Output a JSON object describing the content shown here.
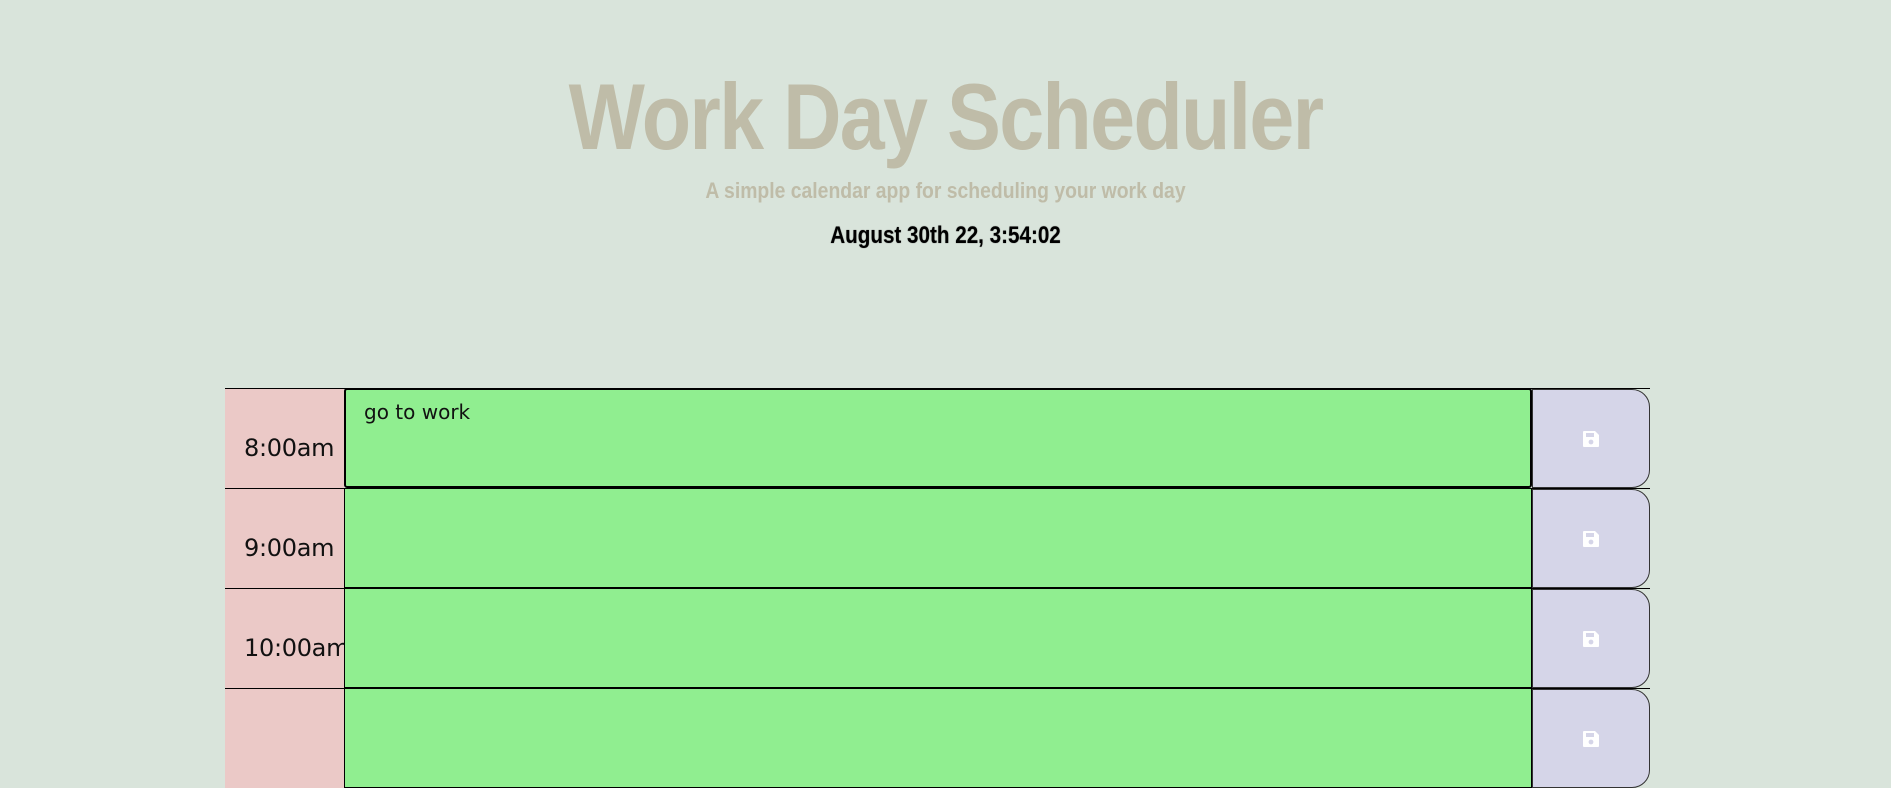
{
  "header": {
    "title": "Work Day Scheduler",
    "subtitle": "A simple calendar app for scheduling your work day",
    "current_day": "August 30th 22, 3:54:02"
  },
  "colors": {
    "background": "#d9e4db",
    "hour_bg": "#ebc9c7",
    "future_bg": "#90ee90",
    "save_bg": "#d5d5e8"
  },
  "blocks": [
    {
      "hour": "8:00am",
      "text": "go to work",
      "icon": "save-icon"
    },
    {
      "hour": "9:00am",
      "text": "",
      "icon": "save-icon"
    },
    {
      "hour": "10:00am",
      "text": "",
      "icon": "save-icon"
    },
    {
      "hour": "",
      "text": "",
      "icon": "save-icon"
    }
  ]
}
